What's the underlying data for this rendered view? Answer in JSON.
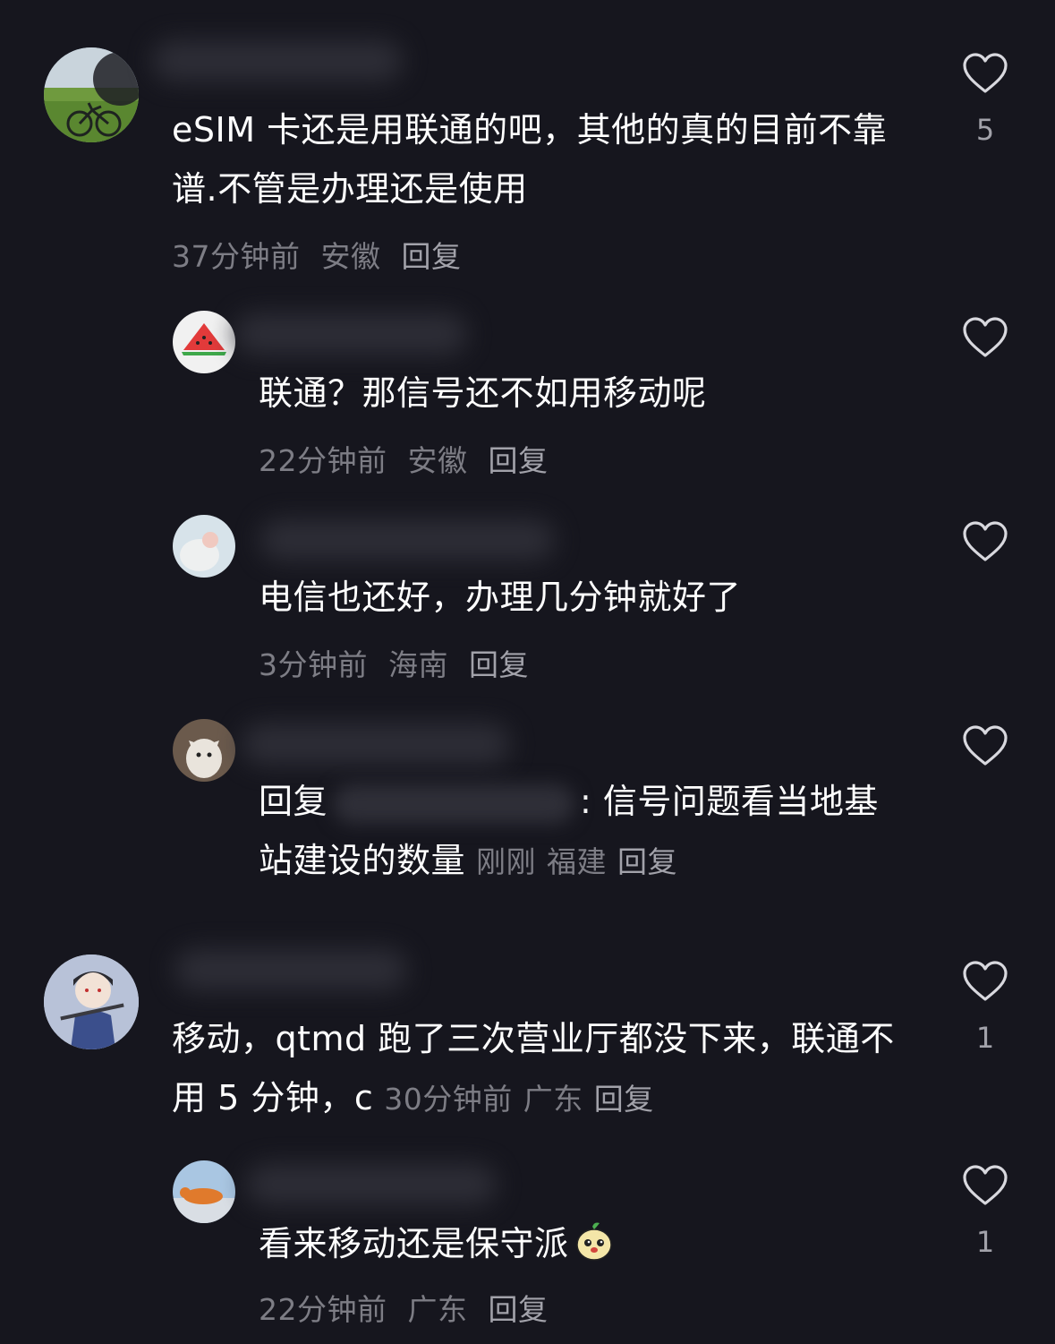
{
  "comments": [
    {
      "text": "eSIM 卡还是用联通的吧，其他的真的目前不靠谱.不管是办理还是使用",
      "time": "37分钟前",
      "location": "安徽",
      "reply_label": "回复",
      "likes": "5"
    },
    {
      "text": "联通？那信号还不如用移动呢",
      "time": "22分钟前",
      "location": "安徽",
      "reply_label": "回复",
      "likes": ""
    },
    {
      "text": "电信也还好，办理几分钟就好了",
      "time": "3分钟前",
      "location": "海南",
      "reply_label": "回复",
      "likes": ""
    },
    {
      "reply_prefix": "回复",
      "text_tail": ": 信号问题看当地基站建设的数量",
      "time": "刚刚",
      "location": "福建",
      "reply_label": "回复",
      "likes": ""
    },
    {
      "text": "移动，qtmd 跑了三次营业厅都没下来，联通不用 5 分钟，c",
      "time": "30分钟前",
      "location": "广东",
      "reply_label": "回复",
      "likes": "1"
    },
    {
      "text": "看来移动还是保守派",
      "time": "22分钟前",
      "location": "广东",
      "reply_label": "回复",
      "likes": "1"
    }
  ],
  "icons": {
    "like": "heart-outline-icon",
    "emoji": "pear-emoji-icon"
  },
  "colors": {
    "background": "#16161e",
    "text": "#ffffff",
    "meta": "#7d7d85",
    "reply": "#a2a2aa"
  }
}
